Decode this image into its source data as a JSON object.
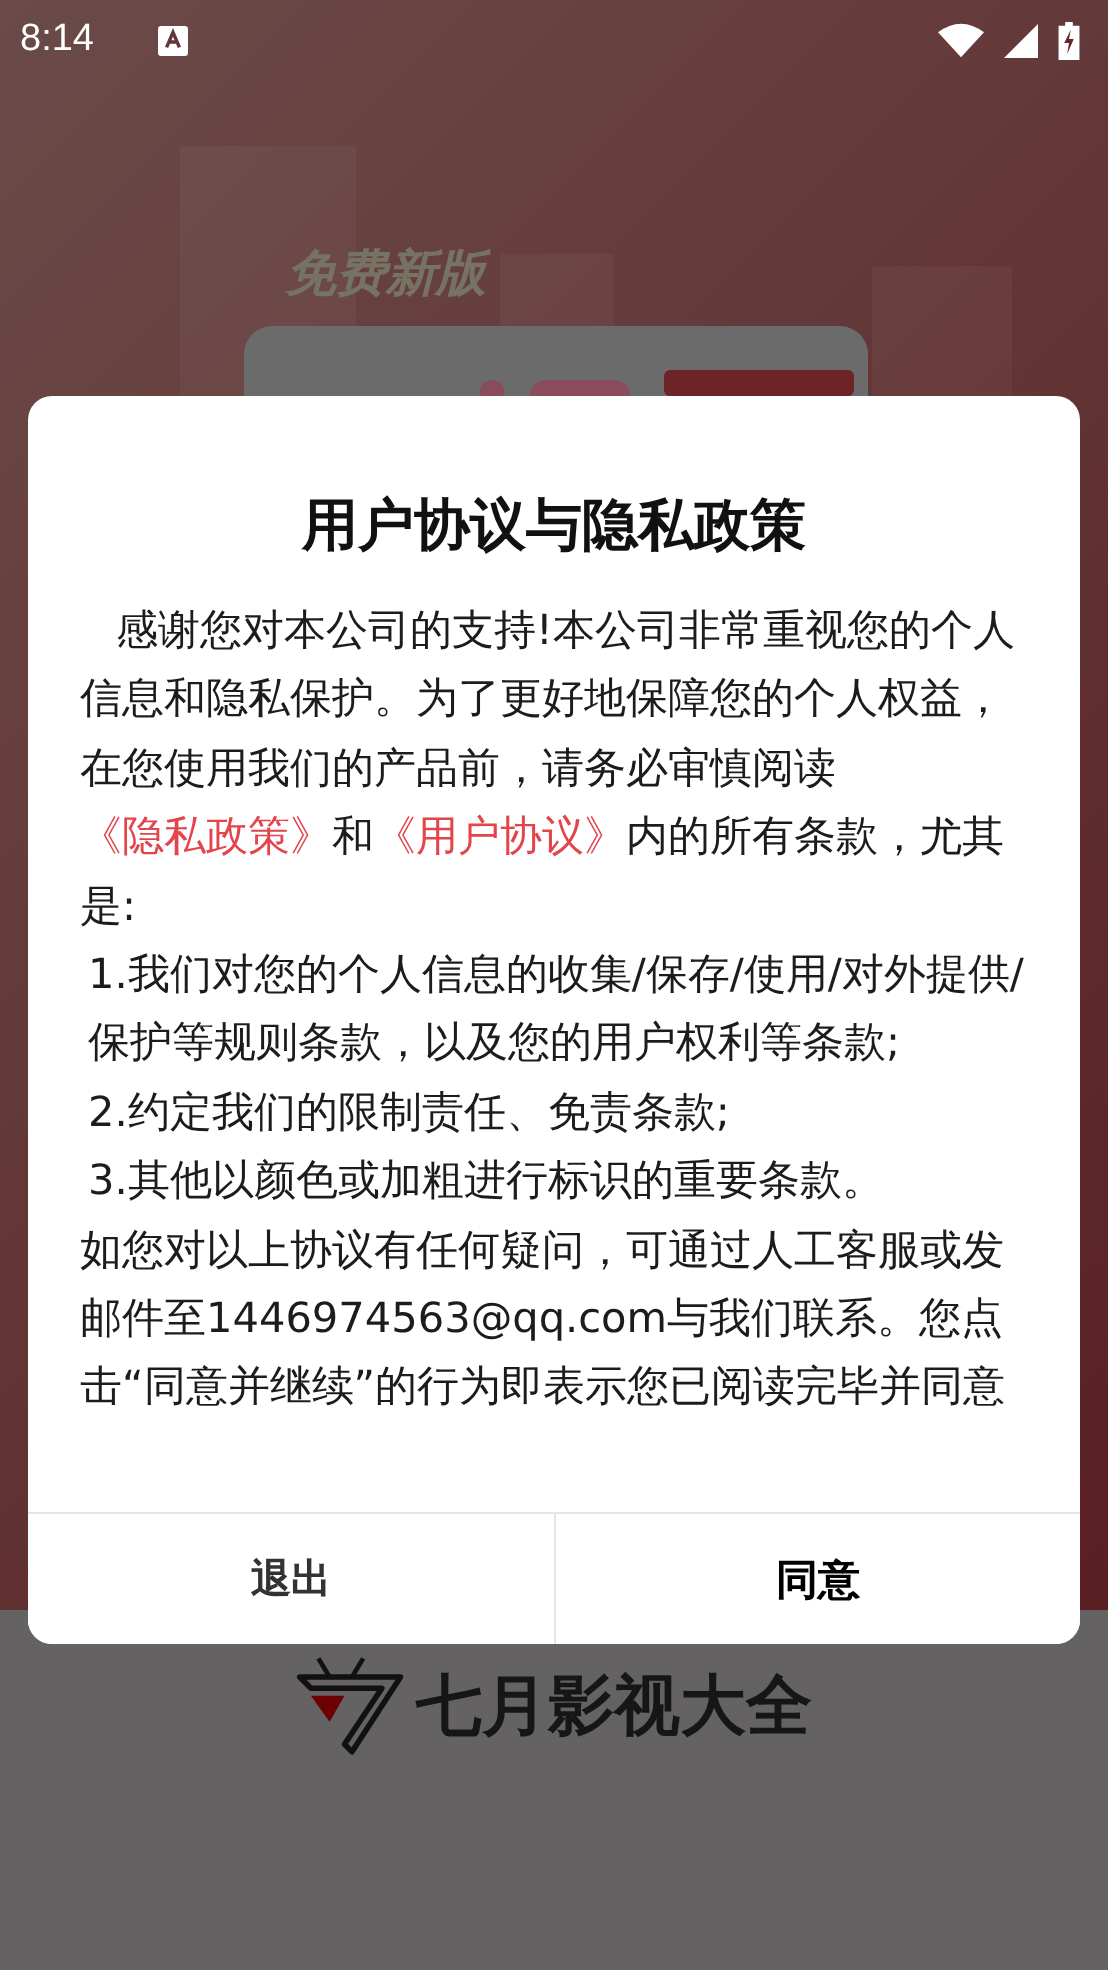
{
  "status_bar": {
    "time": "8:14"
  },
  "background": {
    "tagline": "免费新版",
    "brand": "七月影视大全"
  },
  "dialog": {
    "title": "用户协议与隐私政策",
    "paragraphs": [
      {
        "kind": "intro",
        "segments": [
          {
            "kind": "text",
            "text": "感谢您对本公司的支持!本公司非常重视您的个人信息和隐私保护。为了更好地保障您的个人权益，在您使用我们的产品前，请务必审慎阅读"
          },
          {
            "kind": "link",
            "text": "《隐私政策》"
          },
          {
            "kind": "text",
            "text": "和"
          },
          {
            "kind": "link",
            "text": "《用户协议》"
          },
          {
            "kind": "text",
            "text": "内的所有条款，尤其是:"
          }
        ]
      },
      {
        "kind": "item",
        "segments": [
          {
            "kind": "text",
            "text": "1.我们对您的个人信息的收集/保存/使用/对外提供/保护等规则条款，以及您的用户权利等条款;"
          }
        ]
      },
      {
        "kind": "item",
        "segments": [
          {
            "kind": "text",
            "text": "2.约定我们的限制责任、免责条款;"
          }
        ]
      },
      {
        "kind": "item",
        "segments": [
          {
            "kind": "text",
            "text": "3.其他以颜色或加粗进行标识的重要条款。"
          }
        ]
      },
      {
        "kind": "plain",
        "segments": [
          {
            "kind": "text",
            "text": "如您对以上协议有任何疑问，可通过人工客服或发邮件至1446974563@qq.com与我们联系。您点击“同意并继续”的行为即表示您已阅读完毕并同意"
          }
        ]
      }
    ],
    "buttons": [
      {
        "label": "退出",
        "primary": false
      },
      {
        "label": "同意",
        "primary": true
      }
    ]
  }
}
